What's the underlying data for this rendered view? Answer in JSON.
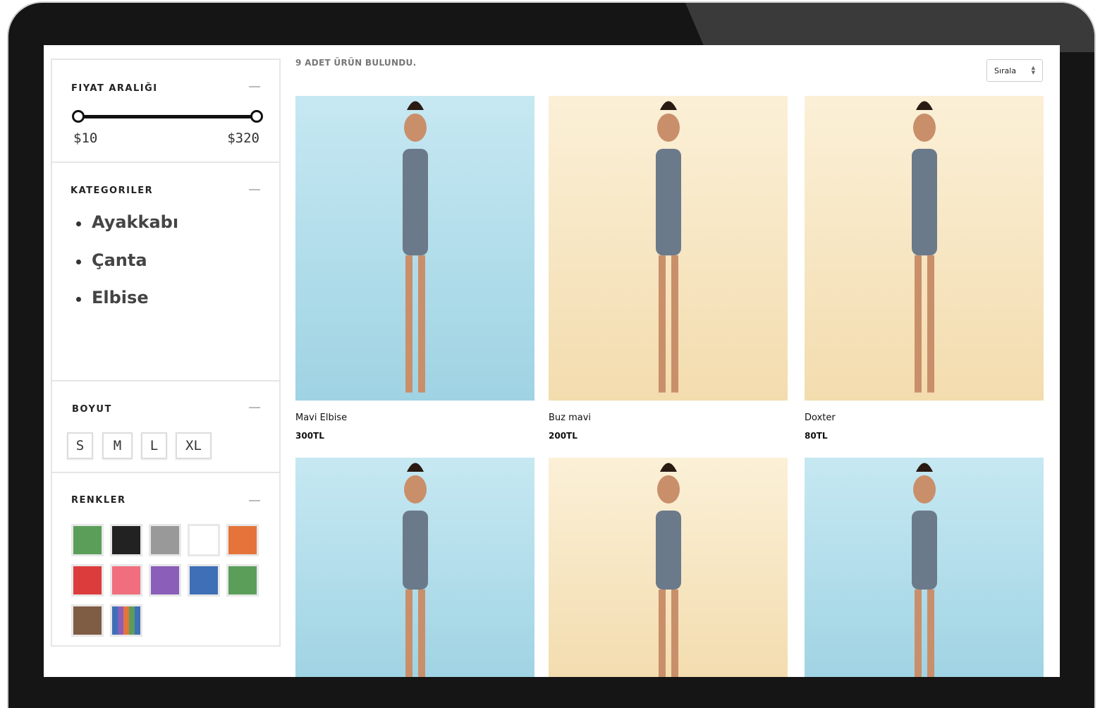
{
  "filters": {
    "price": {
      "title": "FIYAT ARALIĞI",
      "min_label": "$10",
      "max_label": "$320"
    },
    "categories": {
      "title": "KATEGORILER",
      "items": [
        "Ayakkabı",
        "Çanta",
        "Elbise"
      ]
    },
    "size": {
      "title": "BOYUT",
      "options": [
        "S",
        "M",
        "L",
        "XL"
      ]
    },
    "colors": {
      "title": "RENKLER",
      "swatches": [
        "#5a9e5a",
        "#222222",
        "#999999",
        "#ffffff",
        "#e4743a",
        "#dc3c3c",
        "#f06e7d",
        "#8a5eb9",
        "#3f6fb6",
        "#5a9e5a",
        "#7f5c44",
        "multi"
      ]
    }
  },
  "results": {
    "count_text": "9 ADET ÜRÜN BULUNDU.",
    "sort_label": "Sırala"
  },
  "products": [
    {
      "name": "Mavi Elbise",
      "price": "300TL",
      "background": "blue"
    },
    {
      "name": "Buz mavi",
      "price": "200TL",
      "background": "cream"
    },
    {
      "name": "Doxter",
      "price": "80TL",
      "background": "cream"
    },
    {
      "name": "",
      "price": "",
      "background": "blue"
    },
    {
      "name": "",
      "price": "",
      "background": "cream"
    },
    {
      "name": "",
      "price": "",
      "background": "blue"
    }
  ]
}
